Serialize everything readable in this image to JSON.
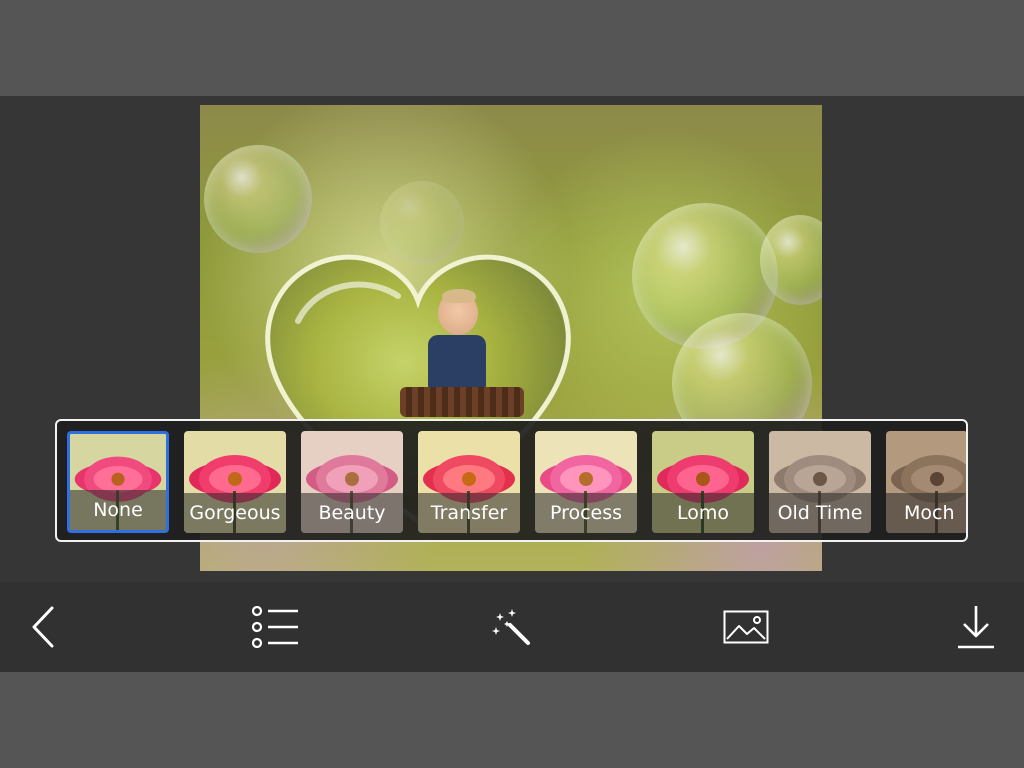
{
  "filters": {
    "items": [
      {
        "label": "None",
        "selected": true,
        "tone": "natural"
      },
      {
        "label": "Gorgeous",
        "selected": false,
        "tone": "warm"
      },
      {
        "label": "Beauty",
        "selected": false,
        "tone": "soft"
      },
      {
        "label": "Transfer",
        "selected": false,
        "tone": "warm"
      },
      {
        "label": "Process",
        "selected": false,
        "tone": "soft"
      },
      {
        "label": "Lomo",
        "selected": false,
        "tone": "natural"
      },
      {
        "label": "Old Time",
        "selected": false,
        "tone": "sepia"
      },
      {
        "label": "Moch",
        "selected": false,
        "tone": "sepia"
      }
    ]
  },
  "toolbar": {
    "icons": [
      "back-chevron-icon",
      "list-icon",
      "magic-wand-icon",
      "image-icon",
      "download-icon"
    ]
  },
  "colors": {
    "selection": "#2f6fe0",
    "toolbar_bg": "#313131",
    "editor_bg": "#363636",
    "outer_bg": "#555555"
  }
}
